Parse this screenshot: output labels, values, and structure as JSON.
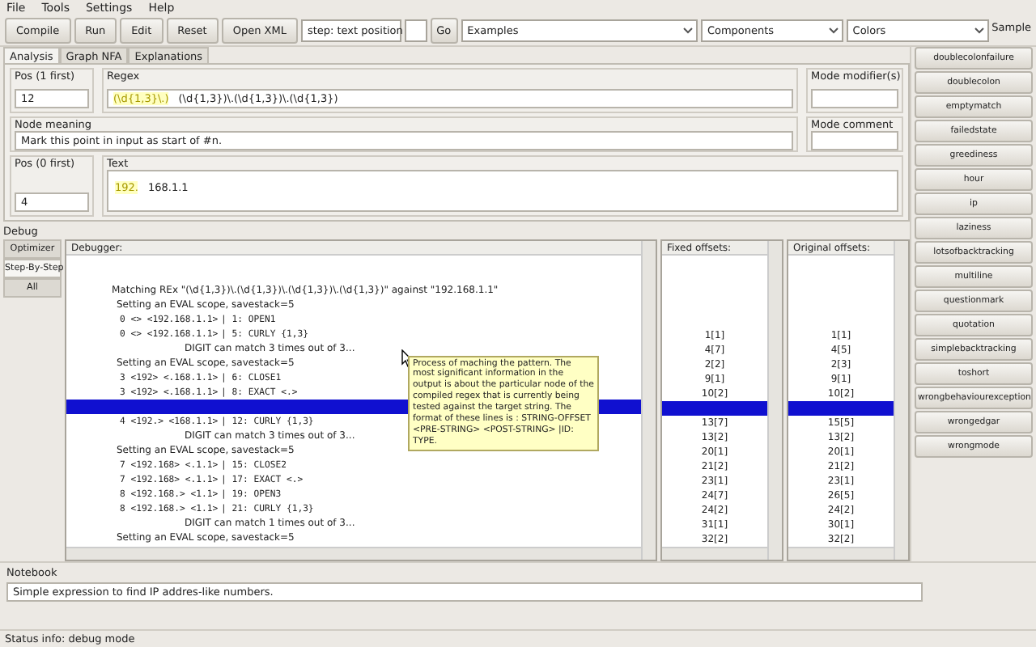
{
  "menu": [
    "File",
    "Tools",
    "Settings",
    "Help"
  ],
  "toolbar": {
    "buttons": [
      "Compile",
      "Run",
      "Edit",
      "Reset",
      "Open XML"
    ],
    "step_select": "step: text position",
    "go": "Go",
    "examples": "Examples",
    "components": "Components",
    "colors": "Colors",
    "sample_label": "Sample"
  },
  "tabs": [
    {
      "label": "Analysis",
      "selected": true
    },
    {
      "label": "Graph NFA",
      "selected": false
    },
    {
      "label": "Explanations",
      "selected": false
    }
  ],
  "analysis": {
    "pos1": {
      "label": "Pos (1 first)",
      "value": "12"
    },
    "regex": {
      "label": "Regex",
      "matched": "(\\d{1,3}\\.)",
      "rest": "(\\d{1,3})\\.(\\d{1,3})\\.(\\d{1,3})"
    },
    "mode_modifiers": {
      "label": "Mode modifier(s)"
    },
    "node_meaning": {
      "label": "Node meaning",
      "value": "Mark this point in input as start of #n."
    },
    "mode_comment": {
      "label": "Mode comment"
    },
    "pos0": {
      "label": "Pos (0 first)",
      "value": "4"
    },
    "text": {
      "label": "Text",
      "matched": "192.",
      "rest": "168.1.1"
    }
  },
  "debug": {
    "label": "Debug",
    "side_tabs": [
      {
        "label": "Optimizer",
        "selected": false
      },
      {
        "label": "Step-By-Step",
        "selected": true
      },
      {
        "label": "All",
        "selected": false
      }
    ],
    "debugger": {
      "title": "Debugger:",
      "lines": [
        {
          "kind": "heading",
          "text": "Matching REx \"(\\d{1,3})\\.(\\d{1,3})\\.(\\d{1,3})\\.(\\d{1,3})\" against \"192.168.1.1\""
        },
        {
          "kind": "scope",
          "text": "Setting an EVAL scope, savestack=5"
        },
        {
          "kind": "step",
          "offset": "0 <> <192.168.1.1>",
          "node": "|  1:  OPEN1"
        },
        {
          "kind": "step",
          "offset": "0 <> <192.168.1.1>",
          "node": "|  5:  CURLY {1,3}"
        },
        {
          "kind": "note",
          "text": "DIGIT can match 3 times out of 3..."
        },
        {
          "kind": "scope",
          "text": "Setting an EVAL scope, savestack=5"
        },
        {
          "kind": "step",
          "offset": "3 <192> <.168.1.1>",
          "node": "|  6:   CLOSE1"
        },
        {
          "kind": "step",
          "offset": "3 <192> <.168.1.1>",
          "node": "|  8:   EXACT <.>"
        },
        {
          "kind": "selected"
        },
        {
          "kind": "step",
          "offset": "4 <192.> <168.1.1>",
          "node": "| 12:   CURLY {1,3}"
        },
        {
          "kind": "note",
          "text": "DIGIT can match 3 times out of 3..."
        },
        {
          "kind": "scope",
          "text": "Setting an EVAL scope, savestack=5"
        },
        {
          "kind": "step",
          "offset": "7 <192.168> <.1.1>",
          "node": "| 15:     CLOSE2"
        },
        {
          "kind": "step",
          "offset": "7 <192.168> <.1.1>",
          "node": "| 17:     EXACT <.>"
        },
        {
          "kind": "step",
          "offset": "8 <192.168.> <1.1>",
          "node": "| 19:     OPEN3"
        },
        {
          "kind": "step",
          "offset": "8 <192.168.> <1.1>",
          "node": "| 21:     CURLY {1,3}"
        },
        {
          "kind": "note",
          "text": "DIGIT can match 1 times out of 3..."
        },
        {
          "kind": "scope",
          "text": "Setting an EVAL scope, savestack=5"
        }
      ]
    },
    "fixed_offsets": {
      "title": "Fixed offsets:",
      "rows": [
        {
          "text": "1[1]",
          "selected": false
        },
        {
          "text": "4[7]",
          "selected": false
        },
        {
          "text": "2[2]",
          "selected": false
        },
        {
          "text": "9[1]",
          "selected": false
        },
        {
          "text": "10[2]",
          "selected": false
        },
        {
          "selected": true
        },
        {
          "text": "13[7]",
          "selected": false
        },
        {
          "text": "13[2]",
          "selected": false
        },
        {
          "text": "20[1]",
          "selected": false
        },
        {
          "text": "21[2]",
          "selected": false
        },
        {
          "text": "23[1]",
          "selected": false
        },
        {
          "text": "24[7]",
          "selected": false
        },
        {
          "text": "24[2]",
          "selected": false
        },
        {
          "text": "31[1]",
          "selected": false
        },
        {
          "text": "32[2]",
          "selected": false
        }
      ]
    },
    "original_offsets": {
      "title": "Original offsets:",
      "rows": [
        {
          "text": "1[1]",
          "selected": false
        },
        {
          "text": "4[5]",
          "selected": false
        },
        {
          "text": "2[3]",
          "selected": false
        },
        {
          "text": "9[1]",
          "selected": false
        },
        {
          "text": "10[2]",
          "selected": false
        },
        {
          "selected": true
        },
        {
          "text": "15[5]",
          "selected": false
        },
        {
          "text": "13[2]",
          "selected": false
        },
        {
          "text": "20[1]",
          "selected": false
        },
        {
          "text": "21[2]",
          "selected": false
        },
        {
          "text": "23[1]",
          "selected": false
        },
        {
          "text": "26[5]",
          "selected": false
        },
        {
          "text": "24[2]",
          "selected": false
        },
        {
          "text": "30[1]",
          "selected": false
        },
        {
          "text": "32[2]",
          "selected": false
        }
      ]
    },
    "tooltip": "Process of maching the pattern. The most significant information in the output is about the particular node of the compiled regex that is currently being tested against the target string. The format of these lines is : STRING-OFFSET <PRE-STRING> <POST-STRING>   |ID: TYPE."
  },
  "samples": [
    "doublecolonfailure",
    "doublecolon",
    "emptymatch",
    "failedstate",
    "greediness",
    "hour",
    "ip",
    "laziness",
    "lotsofbacktracking",
    "multiline",
    "questionmark",
    "quotation",
    "simplebacktracking",
    "toshort",
    "wrongbehaviourexception",
    "wrongedgar",
    "wrongmode"
  ],
  "notebook": {
    "label": "Notebook",
    "value": "Simple expression to find IP addres-like numbers."
  },
  "status_bar": "Status info: debug mode"
}
